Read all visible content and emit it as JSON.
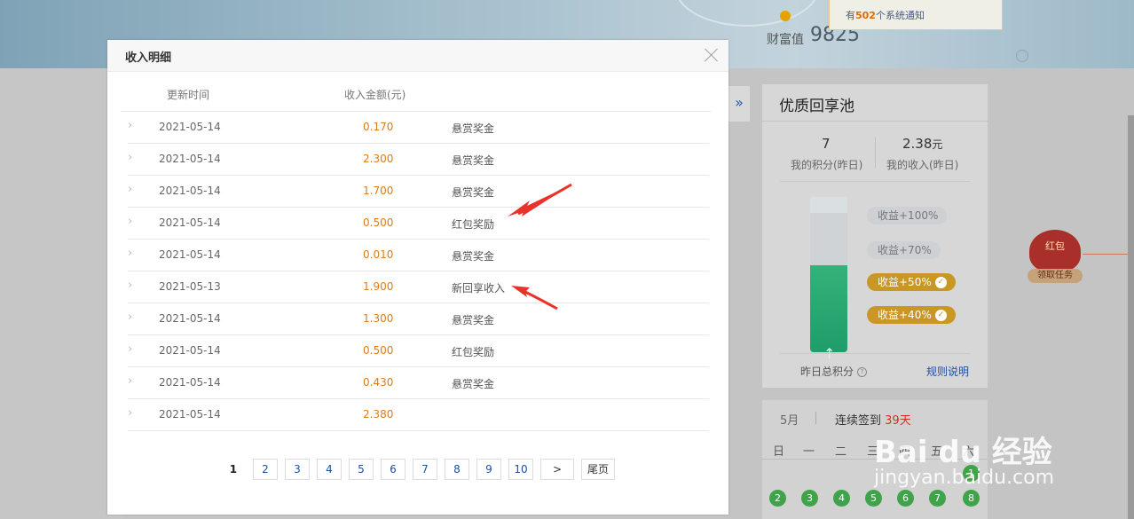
{
  "background": {
    "wealth_label": "财富值",
    "wealth_value": "9825",
    "notice": {
      "prefix": "有",
      "count": "502",
      "suffix": "个系统通知"
    },
    "collapse_icon": "»",
    "pool": {
      "title": "优质回享池",
      "points_value": "7",
      "points_label": "我的积分(昨日)",
      "income_value": "2.38",
      "income_unit": "元",
      "income_label": "我的收入(昨日)",
      "tiers": [
        "收益+100%",
        "收益+70%",
        "收益+50%",
        "收益+40%"
      ],
      "total_label": "昨日总积分",
      "rules_link": "规则说明"
    },
    "calendar": {
      "month": "5月",
      "streak_prefix": "连续签到",
      "streak_days": "39天",
      "weekdays": [
        "日",
        "一",
        "二",
        "三",
        "四",
        "五",
        "六"
      ],
      "days": [
        "1",
        "2",
        "3",
        "4",
        "5",
        "6",
        "7",
        "8"
      ]
    },
    "redpack": {
      "label": "红包",
      "task": "领取任务"
    },
    "watermark": {
      "brand": "Bai du 经验",
      "url": "jingyan.baidu.com"
    }
  },
  "modal": {
    "title": "收入明细",
    "columns": {
      "time": "更新时间",
      "amount": "收入金额(元)"
    },
    "rows": [
      {
        "date": "2021-05-14",
        "amount": "0.170",
        "type": "悬赏奖金"
      },
      {
        "date": "2021-05-14",
        "amount": "2.300",
        "type": "悬赏奖金"
      },
      {
        "date": "2021-05-14",
        "amount": "1.700",
        "type": "悬赏奖金"
      },
      {
        "date": "2021-05-14",
        "amount": "0.500",
        "type": "红包奖励"
      },
      {
        "date": "2021-05-14",
        "amount": "0.010",
        "type": "悬赏奖金"
      },
      {
        "date": "2021-05-13",
        "amount": "1.900",
        "type": "新回享收入"
      },
      {
        "date": "2021-05-14",
        "amount": "1.300",
        "type": "悬赏奖金"
      },
      {
        "date": "2021-05-14",
        "amount": "0.500",
        "type": "红包奖励"
      },
      {
        "date": "2021-05-14",
        "amount": "0.430",
        "type": "悬赏奖金"
      },
      {
        "date": "2021-05-14",
        "amount": "2.380",
        "type": ""
      }
    ],
    "pagination": {
      "current": "1",
      "pages": [
        "2",
        "3",
        "4",
        "5",
        "6",
        "7",
        "8",
        "9",
        "10"
      ],
      "next": ">",
      "last": "尾页"
    }
  },
  "colors": {
    "amount": "#e07b1a",
    "link": "#1f4fa0",
    "tier_active": "#c99724",
    "arrow": "#e8322a"
  }
}
